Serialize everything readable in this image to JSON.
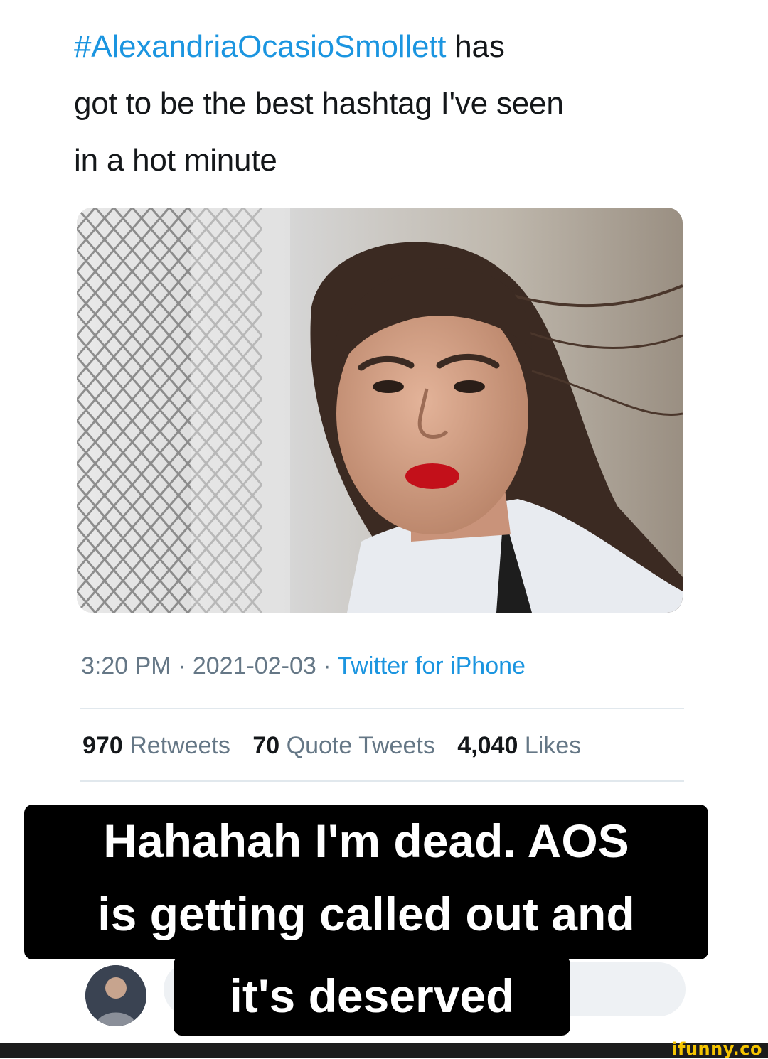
{
  "tweet": {
    "hashtag": "#AlexandriaOcasioSmollett",
    "text_line1_rest": " has",
    "text_line2": "got to be the best hashtag I've seen",
    "text_line3": "in a hot minute",
    "time": "3:20 PM",
    "separator": " · ",
    "date": "2021-02-03",
    "source": "Twitter for iPhone",
    "stats": {
      "retweets_count": "970",
      "retweets_label": "Retweets",
      "quotes_count": "70",
      "quotes_label": "Quote Tweets",
      "likes_count": "4,040",
      "likes_label": "Likes"
    }
  },
  "caption": {
    "line1": "Hahahah I'm dead. AOS",
    "line2": "is getting called out and",
    "line3": "it's deserved"
  },
  "watermark": "ifunny.co",
  "colors": {
    "link": "#1b95e0",
    "meta_gray": "#657786",
    "text": "#14171a",
    "caption_bg": "#000000",
    "watermark": "#f5c400"
  },
  "icons": {
    "avatar": "user-avatar"
  }
}
